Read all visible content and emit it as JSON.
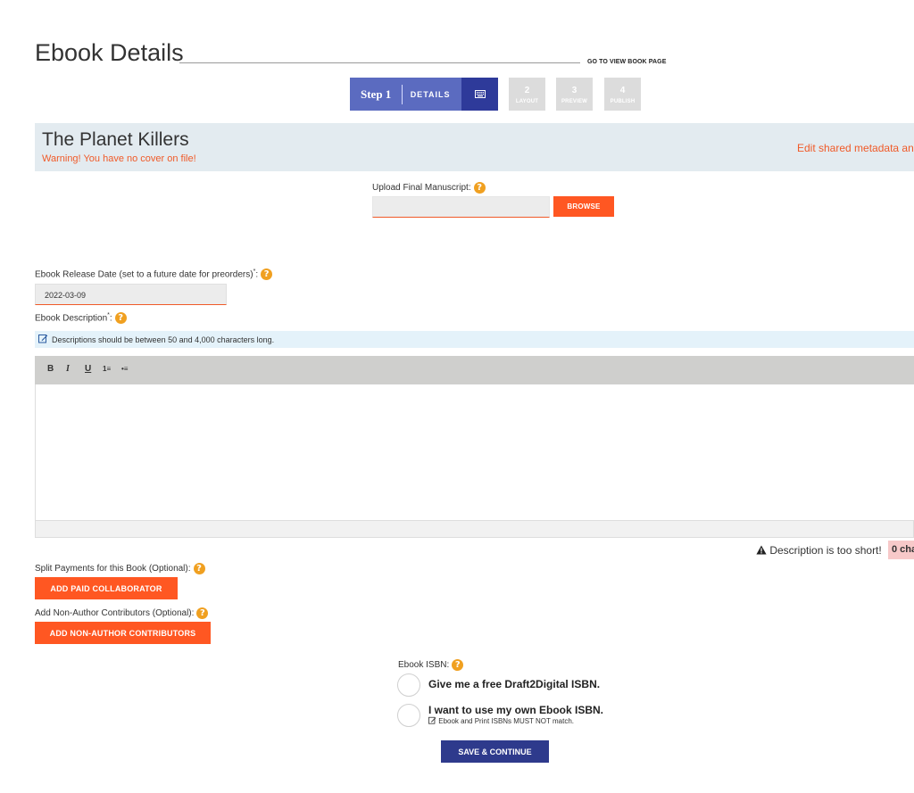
{
  "header": {
    "title": "Ebook Details",
    "view_link": "GO TO VIEW BOOK PAGE"
  },
  "steps": [
    {
      "number": "Step 1",
      "label": "DETAILS",
      "icon": "keyboard-icon",
      "active": true
    },
    {
      "number": "2",
      "label": "LAYOUT",
      "active": false
    },
    {
      "number": "3",
      "label": "PREVIEW",
      "active": false
    },
    {
      "number": "4",
      "label": "PUBLISH",
      "active": false
    }
  ],
  "book": {
    "title": "The Planet Killers",
    "warning": "Warning! You have no cover on file!",
    "edit_link": "Edit shared metadata an"
  },
  "upload": {
    "label": "Upload Final Manuscript:",
    "value": "",
    "button": "BROWSE"
  },
  "release": {
    "label": "Ebook Release Date (set to a future date for preorders)",
    "required_mark": "*",
    "colon": ":",
    "value": "2022-03-09"
  },
  "description": {
    "label": "Ebook Description",
    "required_mark": "*",
    "colon": ":",
    "info": "Descriptions should be between 50 and 4,000 characters long.",
    "toolbar": [
      "B",
      "I",
      "U",
      "1≡",
      "•≡"
    ],
    "too_short": "Description is too short!",
    "char_count": "0 cha"
  },
  "split": {
    "label": "Split Payments for this Book (Optional):",
    "button": "ADD PAID COLLABORATOR"
  },
  "contributors": {
    "label": "Add Non-Author Contributors (Optional):",
    "button": "ADD NON-AUTHOR CONTRIBUTORS"
  },
  "isbn": {
    "label": "Ebook ISBN:",
    "option1": "Give me a free Draft2Digital ISBN.",
    "option2": "I want to use my own Ebook ISBN.",
    "option2_note": "Ebook and Print ISBNs MUST NOT match."
  },
  "save_button": "SAVE & CONTINUE",
  "colors": {
    "accent_orange": "#ff5722",
    "step_active": "#5b6bc0",
    "save_blue": "#2e3a8c",
    "help_icon": "#f0a020"
  }
}
